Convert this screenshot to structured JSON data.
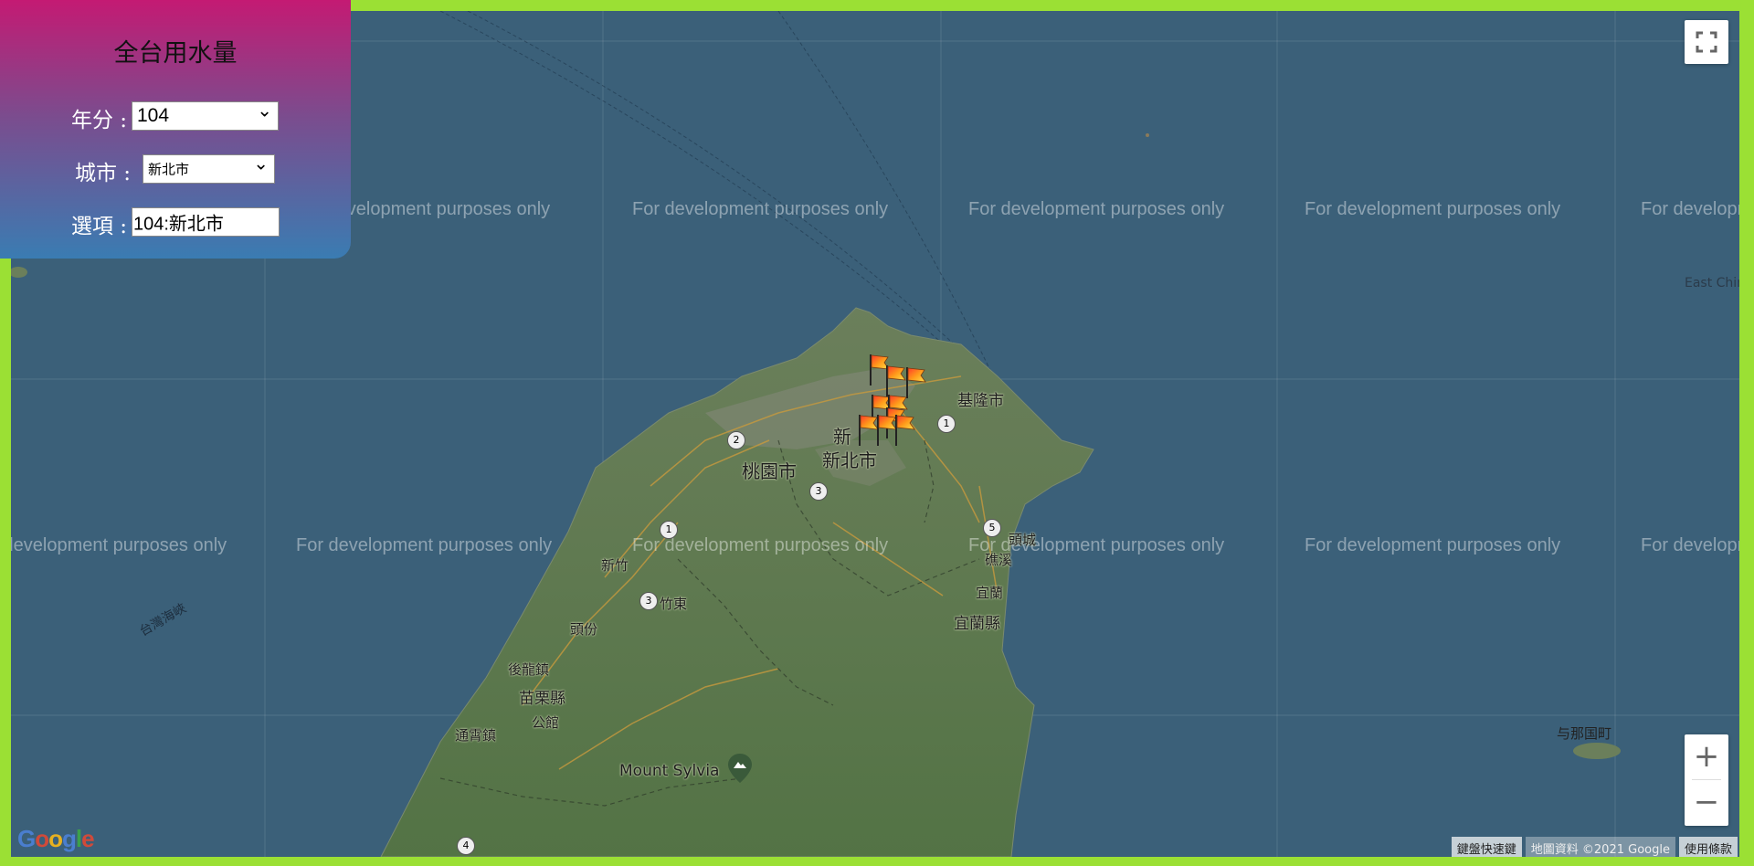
{
  "panel": {
    "title": "全台用水量",
    "year_label": "年分 :",
    "year_value": "104",
    "city_label": "城市 :",
    "city_value": "新北市",
    "option_label": "選項 :",
    "option_value": "104:新北市"
  },
  "map": {
    "watermark": "For development purposes only",
    "places": {
      "keelung": "基隆市",
      "newtaipei": "新北市",
      "newtaipei_partial": "新",
      "taoyuan": "桃園市",
      "hsinchu_partial": "新竹",
      "zhudong": "竹東",
      "toufen": "頭份",
      "houlong": "後龍鎮",
      "miaoli": "苗栗縣",
      "gongguan": "公館",
      "tongxiao": "通霄鎮",
      "toucheng": "頭城",
      "jiaoxi": "礁溪",
      "yilan": "宜蘭",
      "yilan_county": "宜蘭縣",
      "mount_sylvia": "Mount Sylvia",
      "strait": "台灣海峽",
      "east_china": "East Chin",
      "yonaguni": "与那国町"
    },
    "route_numbers": [
      "1",
      "2",
      "3",
      "1",
      "3",
      "5",
      "4"
    ],
    "controls": {
      "fullscreen_icon": "fullscreen-icon",
      "zoom_in": "+",
      "zoom_out": "−"
    },
    "attribution": {
      "shortcuts": "鍵盤快速鍵",
      "data": "地圖資料 ©2021 Google",
      "terms": "使用條款"
    },
    "logo": "Google",
    "marker_icon": "flag-icon",
    "marker_count": 9
  },
  "colors": {
    "border": "#9be034",
    "sea": "#3b6079",
    "land": "#5e7a4c",
    "panel_top": "#c41a73",
    "panel_bottom": "#3a7cb2"
  }
}
